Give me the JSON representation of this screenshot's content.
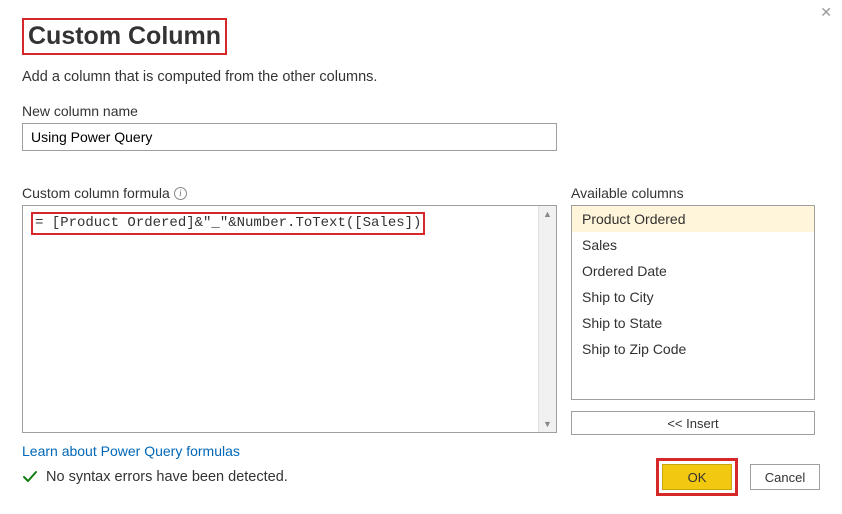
{
  "dialog": {
    "title": "Custom Column",
    "subtitle": "Add a column that is computed from the other columns."
  },
  "name_field": {
    "label": "New column name",
    "value": "Using Power Query"
  },
  "formula": {
    "label": "Custom column formula",
    "value": "= [Product Ordered]&\"_\"&Number.ToText([Sales])"
  },
  "available": {
    "label": "Available columns",
    "items": [
      "Product Ordered",
      "Sales",
      "Ordered Date",
      "Ship to City",
      "Ship to State",
      "Ship to Zip Code"
    ],
    "selected_index": 0,
    "insert_label": "<< Insert"
  },
  "link": {
    "text": "Learn about Power Query formulas"
  },
  "status": {
    "text": "No syntax errors have been detected."
  },
  "buttons": {
    "ok": "OK",
    "cancel": "Cancel"
  }
}
